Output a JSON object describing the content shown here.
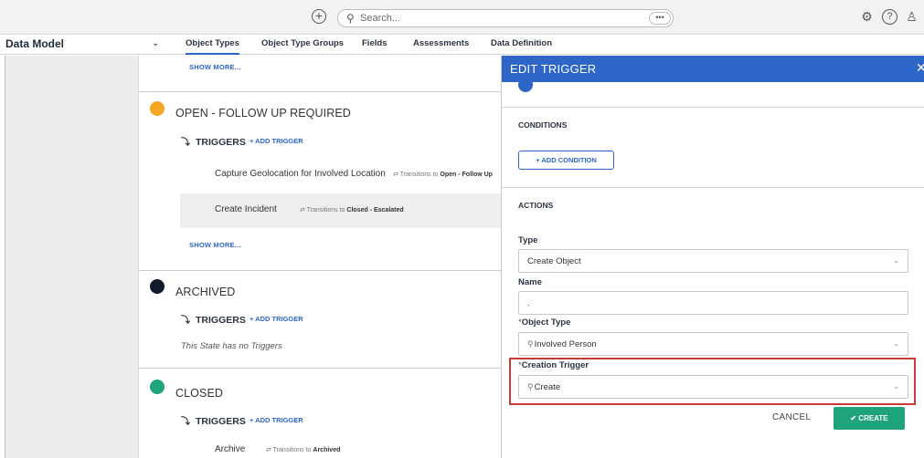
{
  "topbar": {
    "add_glyph": "+",
    "search_placeholder": "Search...",
    "search_more": "•••",
    "gear_glyph": "⚙",
    "help_glyph": "?",
    "user_glyph": "♙"
  },
  "nav": {
    "title": "Data Model",
    "chevron": "⌄",
    "tabs": [
      "Object Types",
      "Object Type Groups",
      "Fields",
      "Assessments",
      "Data Definition"
    ]
  },
  "main": {
    "show_more": "SHOW MORE...",
    "triggers_label": "TRIGGERS",
    "add_trigger": "+ ADD TRIGGER",
    "transitions_to": "⇄ Transitions to",
    "states": {
      "open": {
        "name": "OPEN - FOLLOW UP REQUIRED",
        "color": "#f5a623",
        "triggers": [
          {
            "name": "Capture Geolocation for Involved Location",
            "target": "Open - Follow Up"
          },
          {
            "name": "Create Incident",
            "target": "Closed - Escalated"
          }
        ]
      },
      "archived": {
        "name": "ARCHIVED",
        "color": "#0f1b2d",
        "no_triggers": "This State has no Triggers"
      },
      "closed": {
        "name": "CLOSED",
        "color": "#1fa37b",
        "triggers": [
          {
            "name": "Archive",
            "target": "Archived"
          }
        ]
      }
    }
  },
  "panel": {
    "title": "EDIT TRIGGER",
    "close": "✕",
    "conditions_label": "CONDITIONS",
    "add_condition": "+ ADD CONDITION",
    "actions_label": "ACTIONS",
    "type_label": "Type",
    "type_value": "Create Object",
    "name_label": "Name",
    "name_value": ".",
    "object_type_label": "Object Type",
    "object_type_value": "Involved Person",
    "creation_trigger_label": "Creation Trigger",
    "creation_trigger_value": "Create",
    "required_mark": "*",
    "search_glyph": "⚲",
    "chevron": "⌄",
    "cancel": "CANCEL",
    "create": "✔ CREATE"
  },
  "colors": {
    "accent": "#2e66c7",
    "success": "#1fa37b",
    "highlight": "#c63b36"
  }
}
